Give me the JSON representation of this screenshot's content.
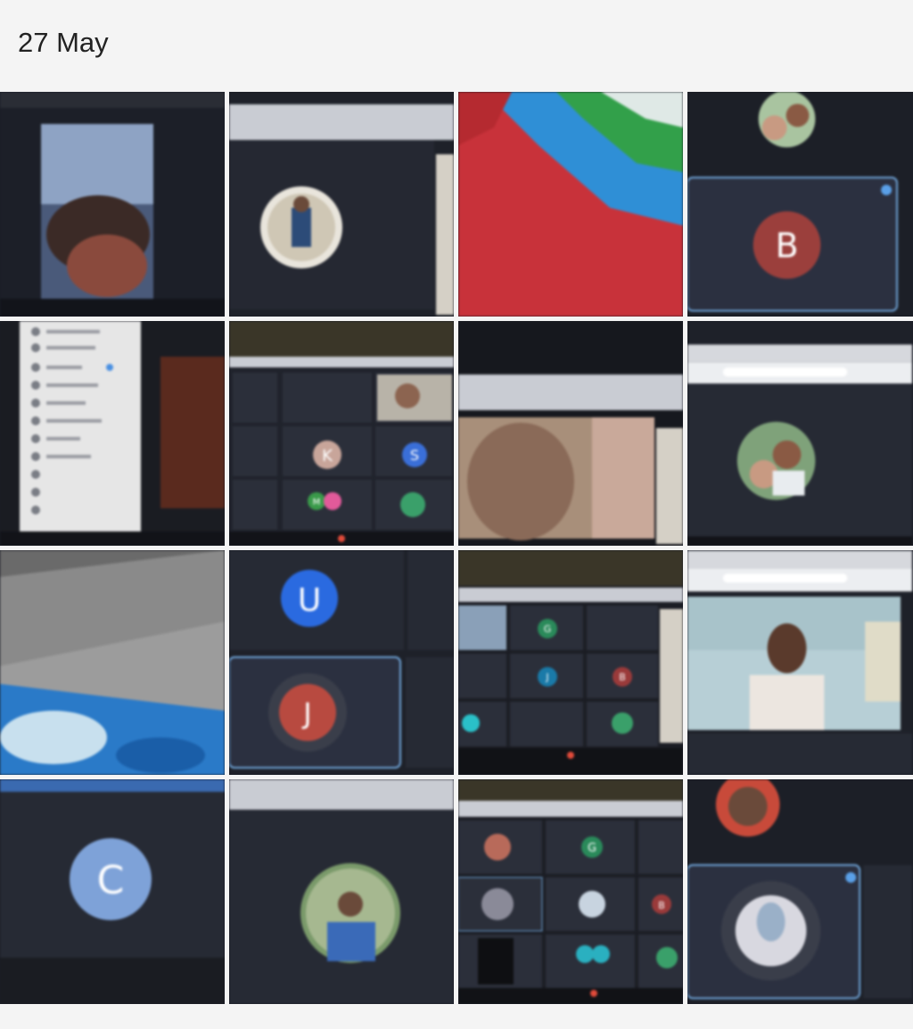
{
  "gallery": {
    "section_date": "27 May",
    "photos": [
      {
        "caption": "",
        "avatar_letter": ""
      },
      {
        "caption": "",
        "avatar_letter": ""
      },
      {
        "caption": "",
        "avatar_letter": ""
      },
      {
        "caption": "",
        "avatar_letter": "B"
      },
      {
        "caption": "",
        "avatar_letter": ""
      },
      {
        "caption": "",
        "avatar_letter": "K"
      },
      {
        "caption": "",
        "avatar_letter": ""
      },
      {
        "caption": "",
        "avatar_letter": ""
      },
      {
        "caption": "",
        "avatar_letter": ""
      },
      {
        "caption": "",
        "avatar_letter": "U"
      },
      {
        "caption": "",
        "avatar_letter": "G"
      },
      {
        "caption": "",
        "avatar_letter": ""
      },
      {
        "caption": "",
        "avatar_letter": "C"
      },
      {
        "caption": "",
        "avatar_letter": ""
      },
      {
        "caption": "",
        "avatar_letter": "G"
      },
      {
        "caption": "",
        "avatar_letter": ""
      }
    ],
    "tile_letters": {
      "t5_s": "S",
      "t5_m": "M",
      "t9_j": "J",
      "t10_j": "J",
      "t10_b": "B",
      "t14_b": "B"
    }
  }
}
